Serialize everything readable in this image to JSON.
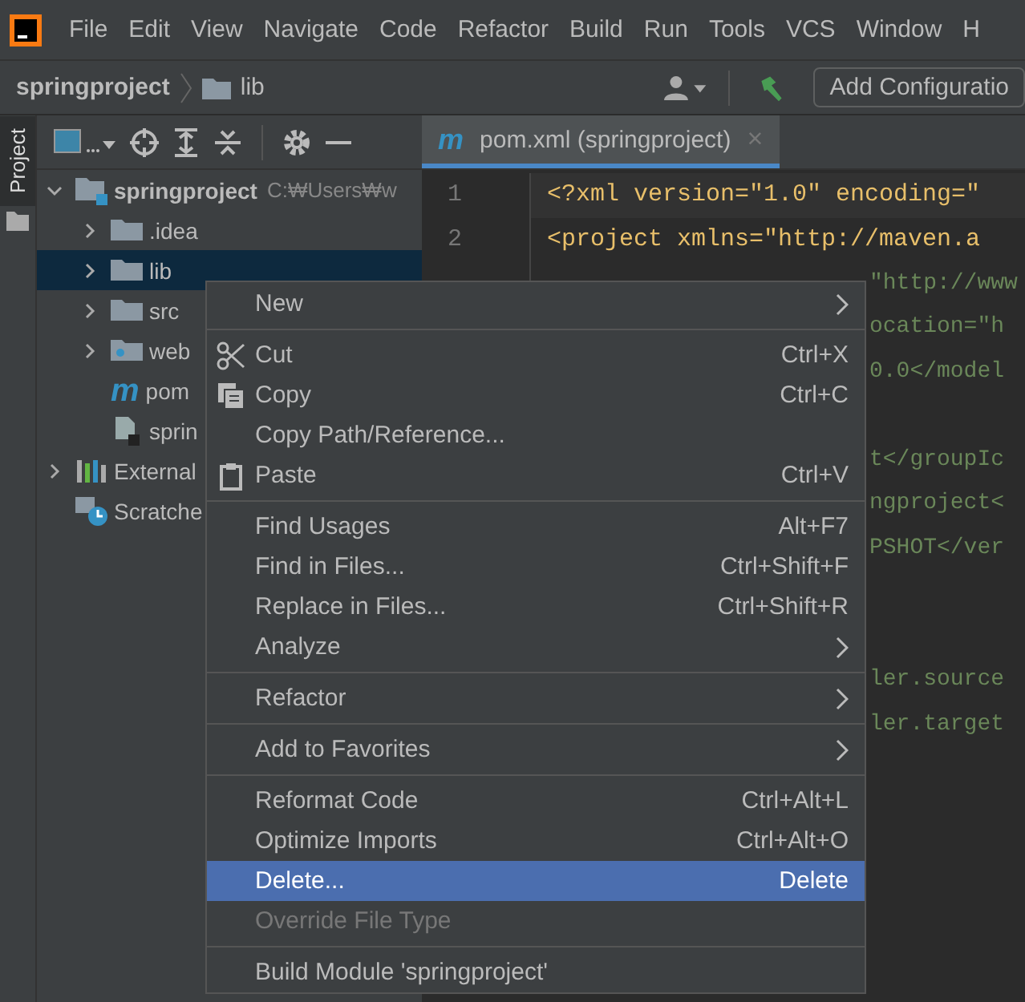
{
  "menu_bar": [
    "File",
    "Edit",
    "View",
    "Navigate",
    "Code",
    "Refactor",
    "Build",
    "Run",
    "Tools",
    "VCS",
    "Window",
    "H"
  ],
  "breadcrumb": {
    "project": "springproject",
    "folder": "lib"
  },
  "toolbar": {
    "run_config": "Add Configuratio"
  },
  "side_stripe": {
    "tab": "Project",
    "selected": true
  },
  "project_tree": [
    {
      "label": "springproject",
      "path": "C:₩Users₩w",
      "kind": "module",
      "expanded": true,
      "selected": false,
      "children": [
        {
          "label": ".idea",
          "kind": "folder",
          "expanded": false,
          "selected": false
        },
        {
          "label": "lib",
          "kind": "folder",
          "expanded": false,
          "selected": true
        },
        {
          "label": "src",
          "kind": "folder",
          "expanded": false,
          "selected": false
        },
        {
          "label": "web",
          "kind": "webfolder",
          "expanded": false,
          "selected": false
        },
        {
          "label": "pom",
          "kind": "maven",
          "badge": "m",
          "selected": false
        },
        {
          "label": "sprin",
          "kind": "file",
          "selected": false
        }
      ]
    },
    {
      "label": "External",
      "kind": "libraries",
      "expanded": false,
      "selected": false
    },
    {
      "label": "Scratche",
      "kind": "scratches",
      "selected": false
    }
  ],
  "editor_tab": {
    "badge": "m",
    "label": "pom.xml (springproject)",
    "close": "×",
    "selected": true
  },
  "code_lines": [
    {
      "number": "1",
      "text": "<?xml version=\"1.0\" encoding=\"",
      "kind": "full"
    },
    {
      "number": "2",
      "text": "<project xmlns=\"http://maven.a",
      "kind": "full"
    },
    {
      "text": "\"http://www",
      "kind": "partial"
    },
    {
      "text": "ocation=\"h",
      "kind": "partial"
    },
    {
      "text": "0.0</model",
      "kind": "partial"
    },
    {
      "kind": "partial"
    },
    {
      "text": "t</groupIc",
      "kind": "partial"
    },
    {
      "text": "ngproject<",
      "kind": "partial"
    },
    {
      "text": "PSHOT</ver",
      "kind": "partial"
    },
    {
      "kind": "partial"
    },
    {
      "kind": "partial"
    },
    {
      "text": "ler.source",
      "kind": "partial"
    },
    {
      "text": "ler.target",
      "kind": "partial"
    }
  ],
  "context_menu": [
    {
      "kind": "item",
      "label": "New",
      "submenu": true,
      "selected": false,
      "disabled": false
    },
    {
      "kind": "separator"
    },
    {
      "kind": "cut",
      "label": "Cut",
      "shortcut": "Ctrl+X",
      "selected": false,
      "disabled": false
    },
    {
      "kind": "copy",
      "label": "Copy",
      "shortcut": "Ctrl+C",
      "selected": false,
      "disabled": false
    },
    {
      "kind": "item",
      "label": "Copy Path/Reference...",
      "selected": false,
      "disabled": false
    },
    {
      "kind": "paste",
      "label": "Paste",
      "shortcut": "Ctrl+V",
      "selected": false,
      "disabled": false
    },
    {
      "kind": "separator"
    },
    {
      "kind": "item",
      "label": "Find Usages",
      "shortcut": "Alt+F7",
      "selected": false,
      "disabled": false
    },
    {
      "kind": "item",
      "label": "Find in Files...",
      "shortcut": "Ctrl+Shift+F",
      "selected": false,
      "disabled": false
    },
    {
      "kind": "item",
      "label": "Replace in Files...",
      "shortcut": "Ctrl+Shift+R",
      "selected": false,
      "disabled": false
    },
    {
      "kind": "item",
      "label": "Analyze",
      "submenu": true,
      "selected": false,
      "disabled": false
    },
    {
      "kind": "separator"
    },
    {
      "kind": "item",
      "label": "Refactor",
      "submenu": true,
      "selected": false,
      "disabled": false
    },
    {
      "kind": "separator"
    },
    {
      "kind": "item",
      "label": "Add to Favorites",
      "submenu": true,
      "selected": false,
      "disabled": false
    },
    {
      "kind": "separator"
    },
    {
      "kind": "item",
      "label": "Reformat Code",
      "shortcut": "Ctrl+Alt+L",
      "selected": false,
      "disabled": false
    },
    {
      "kind": "item",
      "label": "Optimize Imports",
      "shortcut": "Ctrl+Alt+O",
      "selected": false,
      "disabled": false
    },
    {
      "kind": "item",
      "label": "Delete...",
      "shortcut": "Delete",
      "selected": true,
      "disabled": false
    },
    {
      "kind": "item",
      "label": "Override File Type",
      "selected": false,
      "disabled": true
    },
    {
      "kind": "separator"
    },
    {
      "kind": "item",
      "label": "Build Module 'springproject'",
      "selected": false,
      "disabled": false
    }
  ]
}
